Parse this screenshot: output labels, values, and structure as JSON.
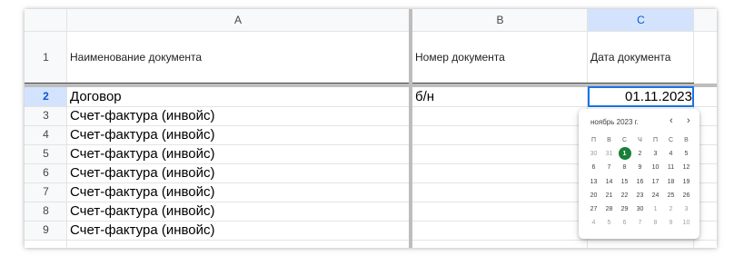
{
  "columns": [
    {
      "letter": "A"
    },
    {
      "letter": "B"
    },
    {
      "letter": "C"
    }
  ],
  "header_row": {
    "number": "1",
    "cells": [
      "Наименование документа",
      "Номер документа",
      "Дата документа"
    ]
  },
  "rows": [
    {
      "number": "2",
      "a": "Договор",
      "b": "б/н",
      "c": "01.11.2023"
    },
    {
      "number": "3",
      "a": "Счет-фактура (инвойс)",
      "b": "",
      "c": ""
    },
    {
      "number": "4",
      "a": "Счет-фактура (инвойс)",
      "b": "",
      "c": ""
    },
    {
      "number": "5",
      "a": "Счет-фактура (инвойс)",
      "b": "",
      "c": ""
    },
    {
      "number": "6",
      "a": "Счет-фактура (инвойс)",
      "b": "",
      "c": ""
    },
    {
      "number": "7",
      "a": "Счет-фактура (инвойс)",
      "b": "",
      "c": ""
    },
    {
      "number": "8",
      "a": "Счет-фактура (инвойс)",
      "b": "",
      "c": ""
    },
    {
      "number": "9",
      "a": "Счет-фактура (инвойс)",
      "b": "",
      "c": ""
    }
  ],
  "selection": {
    "active_cell": "C2",
    "selected_column": "C",
    "selected_row": "2"
  },
  "datepicker": {
    "month_label": "ноябрь 2023 г.",
    "prev_icon": "chevron-left-icon",
    "next_icon": "chevron-right-icon",
    "prev_symbol": "‹",
    "next_symbol": "›",
    "weekdays": [
      "П",
      "В",
      "С",
      "Ч",
      "П",
      "С",
      "В"
    ],
    "weeks": [
      [
        "30",
        "31",
        "1",
        "2",
        "3",
        "4",
        "5"
      ],
      [
        "6",
        "7",
        "8",
        "9",
        "10",
        "11",
        "12"
      ],
      [
        "13",
        "14",
        "15",
        "16",
        "17",
        "18",
        "19"
      ],
      [
        "20",
        "21",
        "22",
        "23",
        "24",
        "25",
        "26"
      ],
      [
        "27",
        "28",
        "29",
        "30",
        "1",
        "2",
        "3"
      ],
      [
        "4",
        "5",
        "6",
        "7",
        "8",
        "9",
        "10"
      ]
    ],
    "muted_leading_count": 2,
    "muted_trailing_week5": 3,
    "selected_day": "1"
  },
  "colors": {
    "selection_border": "#1a73e8",
    "header_selected_bg": "#d3e3fd",
    "today_circle": "#188038"
  }
}
